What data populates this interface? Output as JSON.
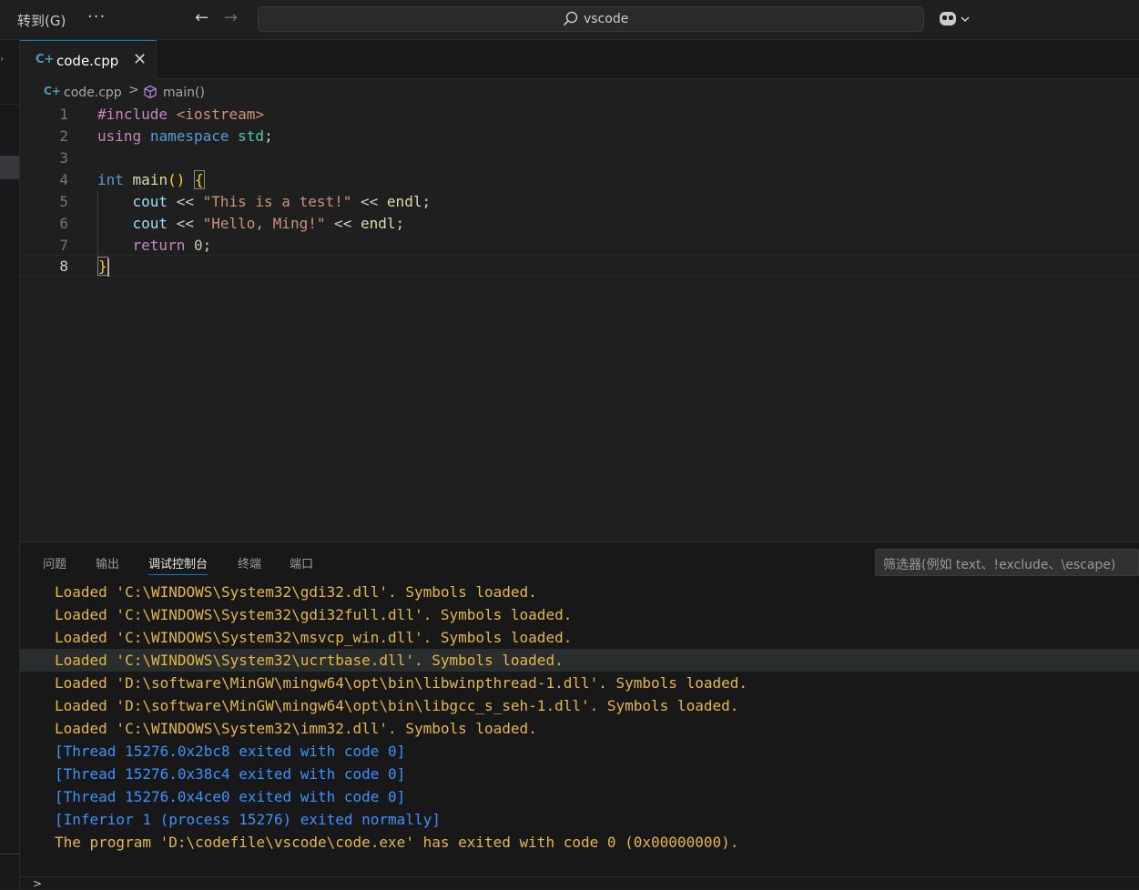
{
  "titlebar": {
    "goto_label": "转到(G)",
    "more_label": "···",
    "back_icon": "←",
    "forward_icon": "→",
    "search_text": "vscode"
  },
  "tab": {
    "icon": "C+",
    "label": "code.cpp",
    "close": "✕"
  },
  "breadcrumb": {
    "file": "code.cpp",
    "separator": ">",
    "symbol": "main()"
  },
  "editor": {
    "line_numbers": [
      "1",
      "2",
      "3",
      "4",
      "5",
      "6",
      "7",
      "8"
    ],
    "current_line": 8,
    "tokens": {
      "l1_include": "#include",
      "l1_header": "<iostream>",
      "l2_using": "using",
      "l2_namespace": "namespace",
      "l2_std": "std",
      "l2_semi": ";",
      "l4_int": "int",
      "l4_main": "main",
      "l4_paren": "()",
      "l4_brace": "{",
      "l5_cout": "cout",
      "l5_op1": "<<",
      "l5_str": "\"This is a test!\"",
      "l5_op2": "<<",
      "l5_endl": "endl",
      "l5_semi": ";",
      "l6_cout": "cout",
      "l6_op1": "<<",
      "l6_str": "\"Hello, Ming!\"",
      "l6_op2": "<<",
      "l6_endl": "endl",
      "l6_semi": ";",
      "l7_return": "return",
      "l7_num": "0",
      "l7_semi": ";",
      "l8_brace": "}"
    }
  },
  "panel": {
    "tabs": [
      "问题",
      "输出",
      "调试控制台",
      "终端",
      "端口"
    ],
    "active_tab": "调试控制台",
    "filter_placeholder": "筛选器(例如 text、!exclude、\\escape)",
    "console_lines": [
      {
        "text": "Loaded 'C:\\WINDOWS\\System32\\gdi32.dll'. Symbols loaded.",
        "kind": "loaded"
      },
      {
        "text": "Loaded 'C:\\WINDOWS\\System32\\gdi32full.dll'. Symbols loaded.",
        "kind": "loaded"
      },
      {
        "text": "Loaded 'C:\\WINDOWS\\System32\\msvcp_win.dll'. Symbols loaded.",
        "kind": "loaded"
      },
      {
        "text": "Loaded 'C:\\WINDOWS\\System32\\ucrtbase.dll'. Symbols loaded.",
        "kind": "loaded"
      },
      {
        "text": "Loaded 'D:\\software\\MinGW\\mingw64\\opt\\bin\\libwinpthread-1.dll'. Symbols loaded.",
        "kind": "loaded"
      },
      {
        "text": "Loaded 'D:\\software\\MinGW\\mingw64\\opt\\bin\\libgcc_s_seh-1.dll'. Symbols loaded.",
        "kind": "loaded"
      },
      {
        "text": "Loaded 'C:\\WINDOWS\\System32\\imm32.dll'. Symbols loaded.",
        "kind": "loaded"
      },
      {
        "text": "[Thread 15276.0x2bc8 exited with code 0]",
        "kind": "thread"
      },
      {
        "text": "[Thread 15276.0x38c4 exited with code 0]",
        "kind": "thread"
      },
      {
        "text": "[Thread 15276.0x4ce0 exited with code 0]",
        "kind": "thread"
      },
      {
        "text": "[Inferior 1 (process 15276) exited normally]",
        "kind": "thread"
      },
      {
        "text": "The program 'D:\\codefile\\vscode\\code.exe' has exited with code 0 (0x00000000).",
        "kind": "loaded"
      }
    ],
    "highlighted_line": 3,
    "repl_prompt": ">"
  },
  "colors": {
    "accent": "#0078d4",
    "console_loaded": "#e5b83e",
    "console_thread": "#3794ff"
  }
}
